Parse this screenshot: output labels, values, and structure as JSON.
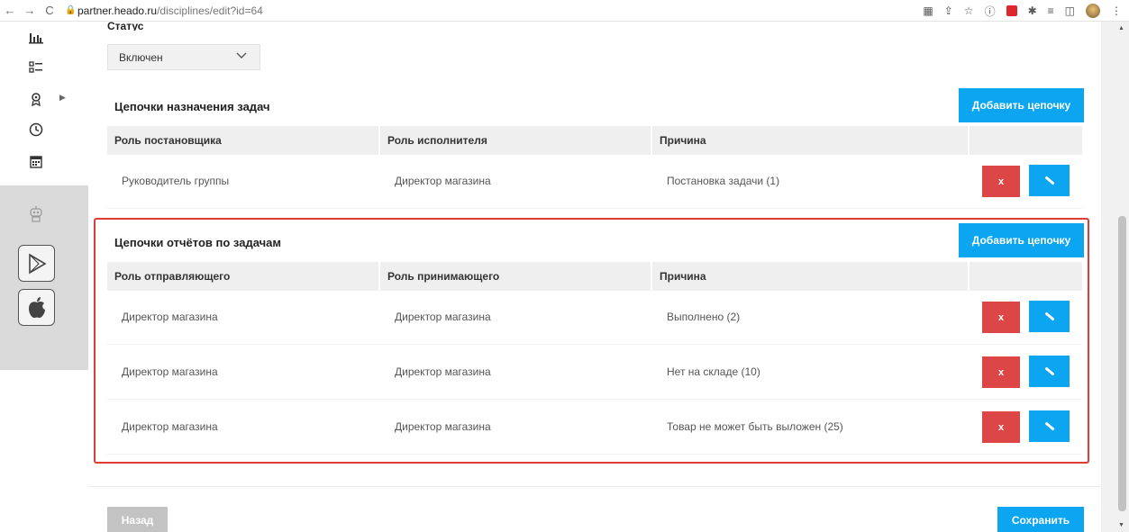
{
  "browser": {
    "nav_back": "←",
    "nav_forward": "→",
    "nav_reload": "C",
    "lock_icon": "lock-icon",
    "url_host": "partner.heado.ru",
    "url_path": "/disciplines/edit?id=64"
  },
  "sidebar": {
    "icons": [
      "bar-chart-icon",
      "checklist-icon",
      "award-icon",
      "clock-icon",
      "calendar-icon",
      "robot-icon"
    ],
    "stores": [
      "google-play-icon",
      "apple-icon"
    ]
  },
  "form": {
    "status_label": "Статус",
    "status_value": "Включен"
  },
  "assignment_chains": {
    "title": "Цепочки назначения задач",
    "add_label": "Добавить цепочку",
    "columns": [
      "Роль постановщика",
      "Роль исполнителя",
      "Причина",
      ""
    ],
    "rows": [
      {
        "from": "Руководитель группы",
        "to": "Директор магазина",
        "reason": "Постановка задачи (1)"
      }
    ]
  },
  "report_chains": {
    "title": "Цепочки отчётов по задачам",
    "add_label": "Добавить цепочку",
    "columns": [
      "Роль отправляющего",
      "Роль принимающего",
      "Причина",
      ""
    ],
    "rows": [
      {
        "from": "Директор магазина",
        "to": "Директор магазина",
        "reason": "Выполнено (2)"
      },
      {
        "from": "Директор магазина",
        "to": "Директор магазина",
        "reason": "Нет на складе (10)"
      },
      {
        "from": "Директор магазина",
        "to": "Директор магазина",
        "reason": "Товар не может быть выложен (25)"
      }
    ]
  },
  "actions": {
    "delete_label": "x",
    "back_label": "Назад",
    "save_label": "Сохранить"
  },
  "colors": {
    "primary": "#0ba5f2",
    "danger": "#dc4646",
    "highlight": "#e03b3b"
  }
}
